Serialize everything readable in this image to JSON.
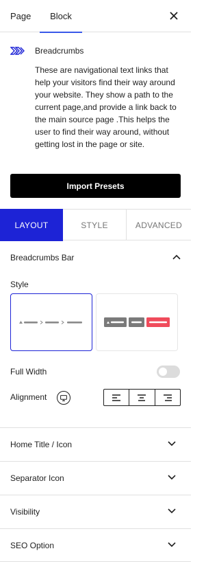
{
  "top_tabs": {
    "page": "Page",
    "block": "Block"
  },
  "block": {
    "name": "Breadcrumbs",
    "icon": "breadcrumbs-icon",
    "description": "These are navigational text links that help your visitors find their way around your website. They show a path to the current page,and provide a link back to the main source page .This helps the user to find their way around, without getting lost in the page or site."
  },
  "import_button": "Import Presets",
  "panel_tabs": {
    "layout": "LAYOUT",
    "style": "STYLE",
    "advanced": "ADVANCED"
  },
  "breadcrumbs_bar": {
    "title": "Breadcrumbs Bar",
    "style_label": "Style",
    "full_width_label": "Full Width",
    "full_width_on": false,
    "alignment_label": "Alignment"
  },
  "sections": [
    {
      "title": "Home Title / Icon"
    },
    {
      "title": "Separator Icon"
    },
    {
      "title": "Visibility"
    },
    {
      "title": "SEO Option"
    }
  ],
  "colors": {
    "accent": "#1d23d6",
    "tab_underline": "#3858e9",
    "button_bg": "#000000",
    "pill_red": "#f04b5b",
    "pill_gray": "#7a7a7a"
  }
}
